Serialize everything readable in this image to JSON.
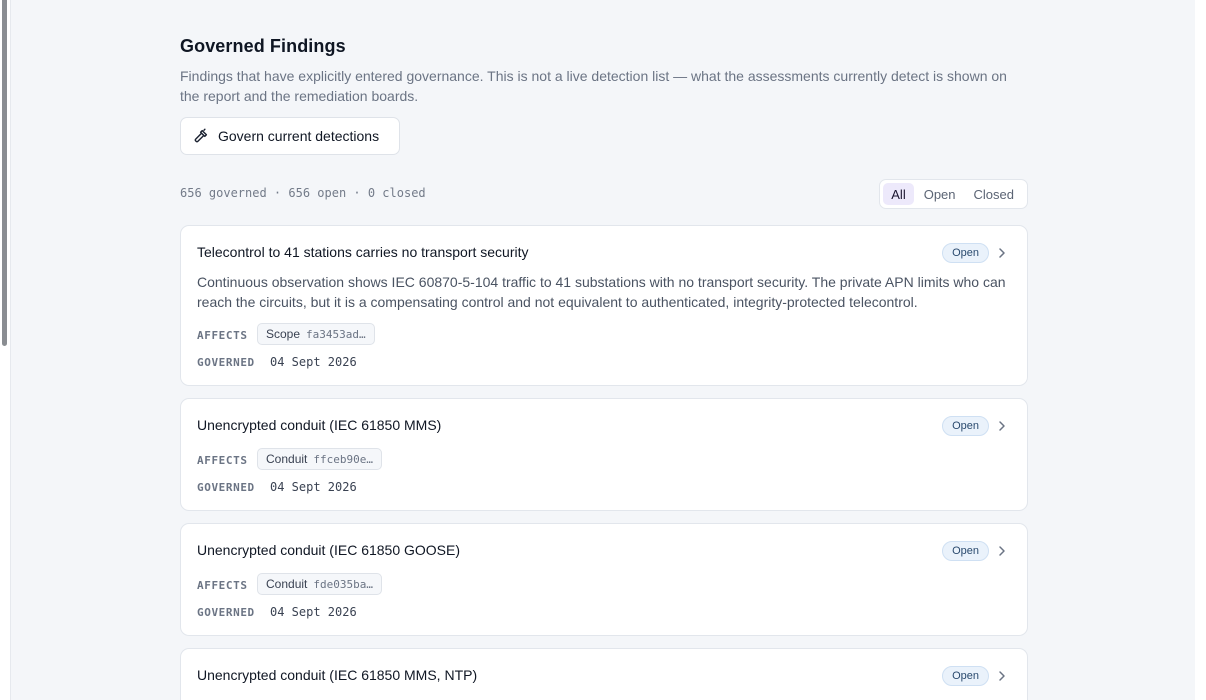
{
  "page": {
    "title": "Governed Findings",
    "description": "Findings that have explicitly entered governance. This is not a live detection list — what the assessments currently detect is shown on the report and the remediation boards.",
    "govern_button_label": "Govern current detections",
    "govern_button_icon": "hammer-icon"
  },
  "stats": {
    "text": "656 governed · 656 open · 0 closed"
  },
  "filters": [
    {
      "label": "All",
      "active": true
    },
    {
      "label": "Open",
      "active": false
    },
    {
      "label": "Closed",
      "active": false
    }
  ],
  "labels": {
    "affects": "AFFECTS",
    "governed": "GOVERNED"
  },
  "findings": [
    {
      "title": "Telecontrol to 41 stations carries no transport security",
      "status": "Open",
      "description": "Continuous observation shows IEC 60870-5-104 traffic to 41 substations with no transport security. The private APN limits who can reach the circuits, but it is a compensating control and not equivalent to authenticated, integrity-protected telecontrol.",
      "affects_type": "Scope",
      "affects_id": "fa3453ad…",
      "governed_date": "04 Sept 2026"
    },
    {
      "title": "Unencrypted conduit (IEC 61850 MMS)",
      "status": "Open",
      "description": "",
      "affects_type": "Conduit",
      "affects_id": "ffceb90e…",
      "governed_date": "04 Sept 2026"
    },
    {
      "title": "Unencrypted conduit (IEC 61850 GOOSE)",
      "status": "Open",
      "description": "",
      "affects_type": "Conduit",
      "affects_id": "fde035ba…",
      "governed_date": "04 Sept 2026"
    },
    {
      "title": "Unencrypted conduit (IEC 61850 MMS, NTP)",
      "status": "Open",
      "description": "",
      "affects_type": "",
      "affects_id": "",
      "governed_date": ""
    }
  ]
}
